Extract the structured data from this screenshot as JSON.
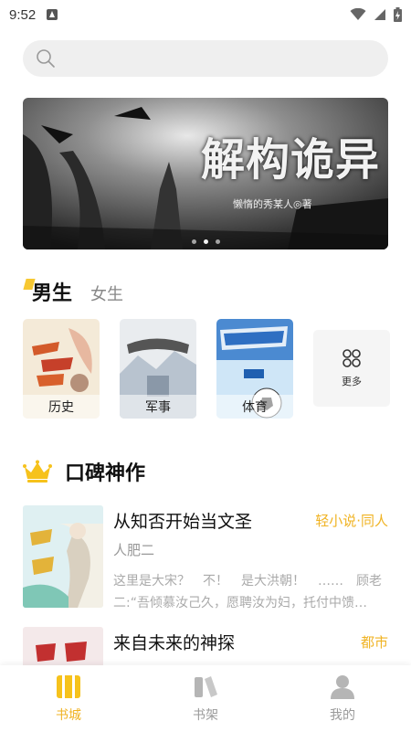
{
  "status_bar": {
    "time": "9:52"
  },
  "banner": {
    "title": "解构诡异",
    "author": "懒惰的秀某人◎著",
    "page_count": 3,
    "active_index": 1
  },
  "gender_tabs": {
    "male": "男生",
    "female": "女生",
    "active": "male"
  },
  "categories": [
    {
      "label": "历史"
    },
    {
      "label": "军事"
    },
    {
      "label": "体育"
    }
  ],
  "more_label": "更多",
  "section": {
    "title": "口碑神作",
    "icon": "crown-icon"
  },
  "books": [
    {
      "title": "从知否开始当文圣",
      "tag": "轻小说·同人",
      "author": "人肥二",
      "desc": "这里是大宋？　不！　是大洪朝！　……　顾老二:“吾倾慕汝己久，愿聘汝为妇，托付中馈…"
    },
    {
      "title": "来自未来的神探",
      "tag": "都市",
      "author": "",
      "desc": ""
    }
  ],
  "bottom_nav": [
    {
      "label": "书城",
      "icon": "bookstore-icon",
      "active": true
    },
    {
      "label": "书架",
      "icon": "bookshelf-icon",
      "active": false
    },
    {
      "label": "我的",
      "icon": "profile-icon",
      "active": false
    }
  ],
  "colors": {
    "accent": "#f0b323",
    "search_bg": "#efefef"
  }
}
